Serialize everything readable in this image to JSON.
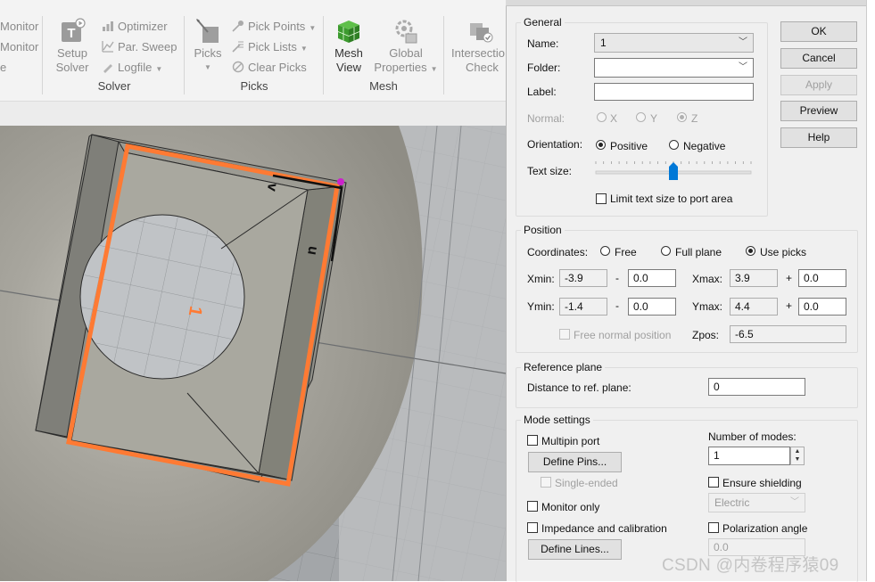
{
  "ribbon": {
    "monitor_1": "Monitor",
    "monitor_2": "Monitor",
    "tail_3": "e",
    "setup_solver": [
      "Setup",
      "Solver"
    ],
    "optimizer": "Optimizer",
    "par_sweep": "Par. Sweep",
    "logfile": "Logfile",
    "group_solver": "Solver",
    "picks_big": "Picks",
    "pick_points": "Pick Points",
    "pick_lists": "Pick Lists",
    "clear_picks": "Clear Picks",
    "group_picks": "Picks",
    "mesh_view": [
      "Mesh",
      "View"
    ],
    "global_properties": [
      "Global",
      "Properties"
    ],
    "group_mesh": "Mesh",
    "intersection_check": [
      "Intersectio",
      "Check"
    ]
  },
  "viewport": {
    "port_number": "1",
    "axis_v": "v",
    "axis_u": "u"
  },
  "dialog": {
    "buttons": {
      "ok": "OK",
      "cancel": "Cancel",
      "apply": "Apply",
      "preview": "Preview",
      "help": "Help"
    },
    "general": {
      "title": "General",
      "name_label": "Name:",
      "name_value": "1",
      "folder_label": "Folder:",
      "folder_value": "",
      "label_label": "Label:",
      "label_value": "",
      "normal_label": "Normal:",
      "normal_options": [
        "X",
        "Y",
        "Z"
      ],
      "normal_selected": "Z",
      "orientation_label": "Orientation:",
      "orientation_options": [
        "Positive",
        "Negative"
      ],
      "orientation_selected": "Positive",
      "text_size_label": "Text size:",
      "text_size_level": 0.5,
      "limit_text_label": "Limit text size to port area",
      "limit_text_checked": false
    },
    "position": {
      "title": "Position",
      "coordinates_label": "Coordinates:",
      "coord_options": [
        "Free",
        "Full plane",
        "Use picks"
      ],
      "coord_selected": "Use picks",
      "xmin_label": "Xmin:",
      "xmin": "-3.9",
      "xmin_offset": "0.0",
      "xmax_label": "Xmax:",
      "xmax": "3.9",
      "xmax_offset": "0.0",
      "ymin_label": "Ymin:",
      "ymin": "-1.4",
      "ymin_offset": "0.0",
      "ymax_label": "Ymax:",
      "ymax": "4.4",
      "ymax_offset": "0.0",
      "minus": "-",
      "plus": "+",
      "free_normal_label": "Free normal position",
      "zpos_label": "Zpos:",
      "zpos": "-6.5"
    },
    "reference": {
      "title": "Reference plane",
      "distance_label": "Distance to ref. plane:",
      "distance": "0"
    },
    "mode": {
      "title": "Mode settings",
      "multipin_label": "Multipin port",
      "define_pins": "Define Pins...",
      "single_ended_label": "Single-ended",
      "monitor_only_label": "Monitor only",
      "impedance_label": "Impedance and calibration",
      "define_lines": "Define Lines...",
      "num_modes_label": "Number of modes:",
      "num_modes": "1",
      "ensure_shielding_label": "Ensure shielding",
      "shielding_value": "Electric",
      "polarization_label": "Polarization angle",
      "polarization_value": "0.0"
    }
  },
  "watermark": "CSDN @内卷程序猿09",
  "colors": {
    "port_orange": "#ff7a33",
    "pick_magenta": "#cc22cc",
    "ok_blue": "#0078d7"
  }
}
